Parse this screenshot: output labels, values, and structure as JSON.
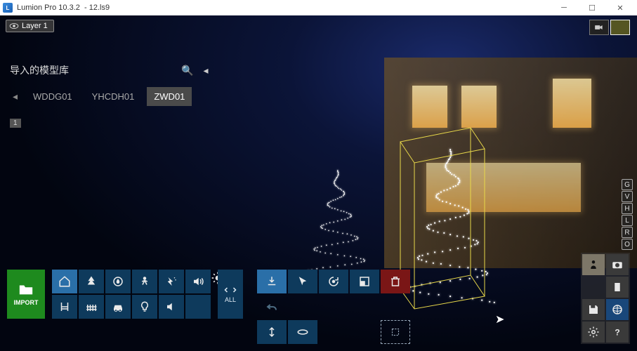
{
  "titlebar": {
    "app": "Lumion Pro 10.3.2",
    "sep": "-",
    "file": "12.ls9"
  },
  "layer": {
    "label": "Layer 1"
  },
  "library": {
    "title": "导入的模型库",
    "tabs": [
      "WDDG01",
      "YHCDH01",
      "ZWD01"
    ],
    "active_tab": 2,
    "page": "1"
  },
  "keystrip": [
    "G",
    "V",
    "H",
    "L",
    "R",
    "O"
  ],
  "toprow_icons": [
    "place-icon",
    "eraser-icon",
    "context-icon",
    "mountain-icon",
    "sun-icon"
  ],
  "import": {
    "label": "IMPORT"
  },
  "category_grid": [
    [
      "home-icon",
      "tree-icon",
      "water-icon",
      "person-icon",
      "fx-icon",
      "sound-icon"
    ],
    [
      "chair-icon",
      "fence-icon",
      "car-icon",
      "light-icon",
      "speaker-icon",
      ""
    ]
  ],
  "category_active": [
    0,
    0
  ],
  "all_label": "ALL",
  "tool_grid": [
    [
      "place-tool-icon",
      "select-icon",
      "rotate-icon",
      "scale-icon",
      "trash-icon",
      "undo-icon"
    ],
    [
      "height-icon",
      "align-icon",
      "",
      "",
      "",
      "marquee-icon"
    ]
  ],
  "tool_active": [
    0,
    0
  ],
  "modes": [
    [
      "worker-icon",
      "camera-icon"
    ],
    [
      "blank",
      "film-icon"
    ],
    [
      "save-icon",
      "globe-icon"
    ],
    [
      "gear-icon",
      "help-icon"
    ]
  ]
}
